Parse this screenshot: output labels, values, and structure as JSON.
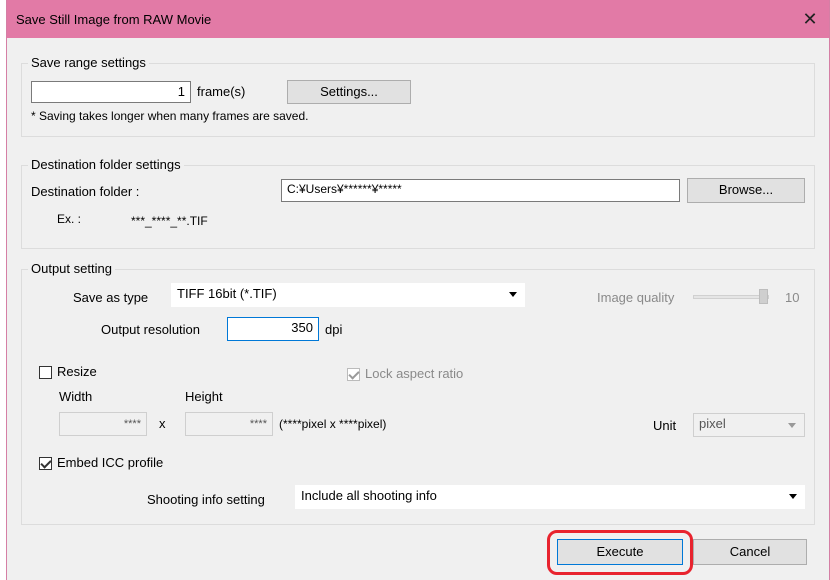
{
  "window": {
    "title": "Save Still Image from RAW Movie",
    "close_glyph": "✕"
  },
  "save_range": {
    "legend": "Save range settings",
    "frames_value": "1",
    "frames_unit": "frame(s)",
    "settings_button": "Settings...",
    "note": "* Saving takes longer when many frames are saved."
  },
  "destination": {
    "legend": "Destination folder settings",
    "folder_label": "Destination folder :",
    "folder_value": "C:¥Users¥******¥*****",
    "browse_button": "Browse...",
    "example_label": "Ex. :",
    "example_value": "***_****_**.TIF"
  },
  "output": {
    "legend": "Output setting",
    "save_type_label": "Save as type",
    "save_type_value": "TIFF 16bit (*.TIF)",
    "image_quality_label": "Image quality",
    "image_quality_value": "10",
    "resolution_label": "Output resolution",
    "resolution_value": "350",
    "resolution_unit": "dpi",
    "resize_label": "Resize",
    "resize_checked": false,
    "lock_aspect_label": "Lock aspect ratio",
    "lock_aspect_checked": true,
    "width_label": "Width",
    "height_label": "Height",
    "width_value": "****",
    "times": "x",
    "height_value": "****",
    "pixel_summary": "(****pixel x ****pixel)",
    "unit_label": "Unit",
    "unit_value": "pixel",
    "embed_icc_label": "Embed ICC profile",
    "embed_icc_checked": true,
    "shooting_info_label": "Shooting info setting",
    "shooting_info_value": "Include all shooting info"
  },
  "actions": {
    "execute": "Execute",
    "cancel": "Cancel"
  },
  "colors": {
    "titlebar": "#e27aa6",
    "highlight": "#e8232e",
    "focus": "#0078d7"
  }
}
